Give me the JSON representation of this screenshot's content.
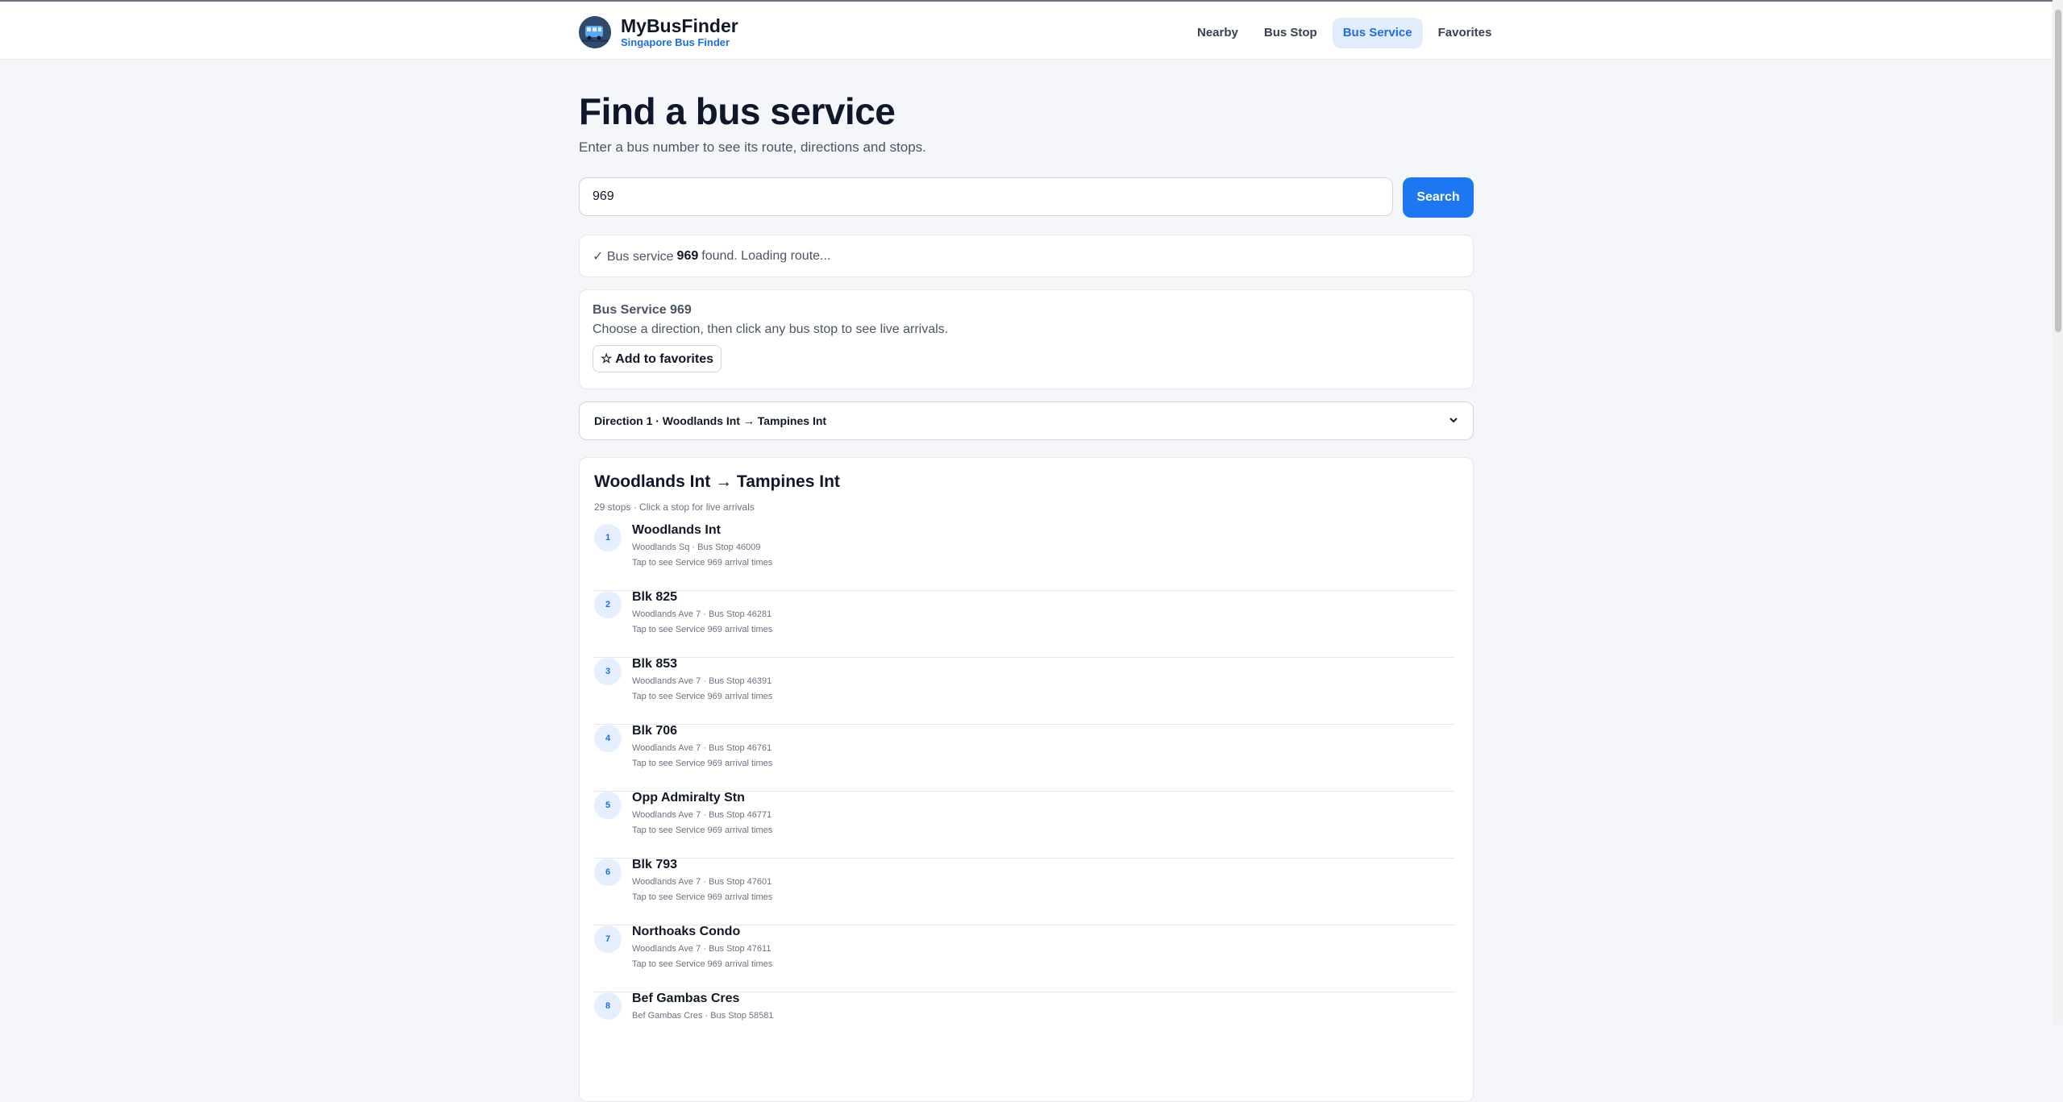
{
  "brand": {
    "title": "MyBusFinder",
    "subtitle": "Singapore Bus Finder",
    "logo_icon": "bus-icon"
  },
  "nav": [
    {
      "label": "Nearby",
      "active": false
    },
    {
      "label": "Bus Stop",
      "active": false
    },
    {
      "label": "Bus Service",
      "active": true
    },
    {
      "label": "Favorites",
      "active": false
    }
  ],
  "page": {
    "title": "Find a bus service",
    "subtitle": "Enter a bus number to see its route, directions and stops."
  },
  "search": {
    "value": "969",
    "placeholder": "",
    "button_label": "Search"
  },
  "status": {
    "prefix": "✓ Bus service",
    "service": "969",
    "suffix": "found. Loading route..."
  },
  "service": {
    "title": "Bus Service 969",
    "description": "Choose a direction, then click any bus stop to see live arrivals.",
    "favorite_label": "☆ Add to favorites"
  },
  "direction": {
    "selected": "Direction 1 · Woodlands Int → Tampines Int"
  },
  "route": {
    "title": "Woodlands Int → Tampines Int",
    "meta": "29 stops · Click a stop for live arrivals",
    "stops": [
      {
        "num": "1",
        "name": "Woodlands Int",
        "road": "Woodlands Sq · Bus Stop 46009",
        "hint": "Tap to see Service 969 arrival times"
      },
      {
        "num": "2",
        "name": "Blk 825",
        "road": "Woodlands Ave 7 · Bus Stop 46281",
        "hint": "Tap to see Service 969 arrival times"
      },
      {
        "num": "3",
        "name": "Blk 853",
        "road": "Woodlands Ave 7 · Bus Stop 46391",
        "hint": "Tap to see Service 969 arrival times"
      },
      {
        "num": "4",
        "name": "Blk 706",
        "road": "Woodlands Ave 7 · Bus Stop 46761",
        "hint": "Tap to see Service 969 arrival times"
      },
      {
        "num": "5",
        "name": "Opp Admiralty Stn",
        "road": "Woodlands Ave 7 · Bus Stop 46771",
        "hint": "Tap to see Service 969 arrival times"
      },
      {
        "num": "6",
        "name": "Blk 793",
        "road": "Woodlands Ave 7 · Bus Stop 47601",
        "hint": "Tap to see Service 969 arrival times"
      },
      {
        "num": "7",
        "name": "Northoaks Condo",
        "road": "Woodlands Ave 7 · Bus Stop 47611",
        "hint": "Tap to see Service 969 arrival times"
      },
      {
        "num": "8",
        "name": "Bef Gambas Cres",
        "road": "Bef Gambas Cres · Bus Stop 58581",
        "hint": ""
      }
    ]
  }
}
